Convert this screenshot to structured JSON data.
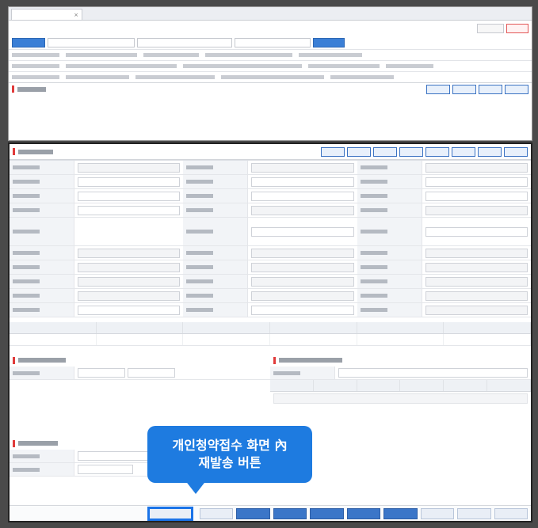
{
  "callout": {
    "line1": "개인청약접수 화면 內",
    "line2": "재발송 버튼"
  },
  "colors": {
    "accent": "#1e7be0",
    "primary_button": "#3b76c8",
    "section_marker": "#e03a3a"
  },
  "icons": {
    "tab_close": "×"
  }
}
